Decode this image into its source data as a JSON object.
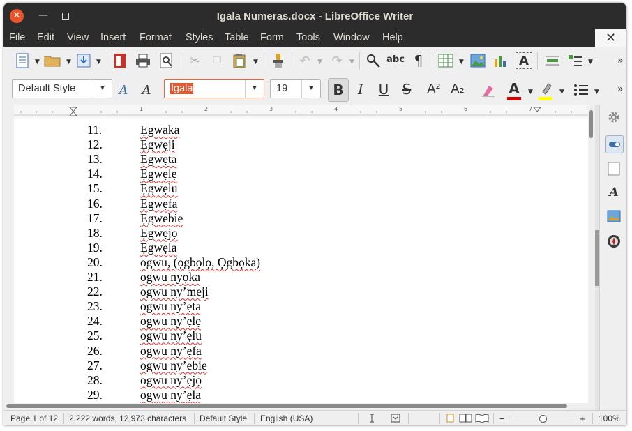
{
  "window": {
    "title": "Igala Numeras.docx - LibreOffice Writer",
    "close_glyph": "✕",
    "minimize_glyph": "—"
  },
  "menu": {
    "items": [
      "File",
      "Edit",
      "View",
      "Insert",
      "Format",
      "Styles",
      "Table",
      "Form",
      "Tools",
      "Window",
      "Help"
    ],
    "close_doc_glyph": "✕"
  },
  "toolbar": {
    "icons": [
      "new-document-icon",
      "open-folder-icon",
      "save-icon",
      "export-pdf-icon",
      "print-icon",
      "print-preview-icon",
      "cut-icon",
      "copy-icon",
      "paste-icon",
      "clone-formatting-icon",
      "undo-icon",
      "redo-icon",
      "find-replace-icon",
      "spellcheck-icon",
      "formatting-marks-icon",
      "insert-table-icon",
      "insert-image-icon",
      "insert-chart-icon",
      "insert-textbox-icon",
      "insert-field-icon",
      "insert-list-icon"
    ],
    "overflow_glyph": "»"
  },
  "format": {
    "paragraph_style": "Default Style",
    "font_name": "Igala",
    "font_size": "19",
    "bold": "B",
    "italic": "I",
    "underline": "U",
    "strike": "S",
    "superscript": "A²",
    "subscript": "A₂",
    "font_color_glyph": "A",
    "font_color": "#cc0000",
    "highlight_color": "#ffff00"
  },
  "ruler": {
    "labels": [
      "1",
      "2",
      "3",
      "4",
      "5",
      "6",
      "7"
    ]
  },
  "document": {
    "lines": [
      {
        "num": "11.",
        "text": "Ẹgwaka"
      },
      {
        "num": "12.",
        "text": "Ẹgwẹji"
      },
      {
        "num": "13.",
        "text": "Ẹgwẹta"
      },
      {
        "num": "14.",
        "text": "Ẹgwẹlẹ"
      },
      {
        "num": "15.",
        "text": "Ẹgwẹlu"
      },
      {
        "num": "16.",
        "text": "Ẹgwẹfa"
      },
      {
        "num": "17.",
        "text": "Ẹgwebie"
      },
      {
        "num": "18.",
        "text": "Ẹgwẹjọ"
      },
      {
        "num": "19.",
        "text": "Ẹgwẹla"
      },
      {
        "num": "20.",
        "text": "ogwu, (ọgbọlọ, Ọgbọka)"
      },
      {
        "num": "21.",
        "text": "ogwu nyọka"
      },
      {
        "num": "22.",
        "text": "ogwu ny’meji"
      },
      {
        "num": "23.",
        "text": "ogwu ny’ẹta"
      },
      {
        "num": "24.",
        "text": "ogwu ny’ẹlẹ"
      },
      {
        "num": "25.",
        "text": "ogwu ny’ẹlu"
      },
      {
        "num": "26.",
        "text": "ogwu ny’ẹfa"
      },
      {
        "num": "27.",
        "text": "ogwu ny’ebie"
      },
      {
        "num": "28.",
        "text": "ogwu ny’ẹjọ"
      },
      {
        "num": "29.",
        "text": "ogwu ny’ẹla"
      }
    ]
  },
  "sidebar": {
    "icons": [
      "gear-icon",
      "properties-icon",
      "page-icon",
      "styles-icon",
      "gallery-icon",
      "navigator-icon"
    ]
  },
  "statusbar": {
    "page": "Page 1 of 12",
    "words": "2,222 words, 12,973 characters",
    "style": "Default Style",
    "language": "English (USA)",
    "zoom": "100%",
    "zoom_minus": "−",
    "zoom_plus": "+"
  }
}
